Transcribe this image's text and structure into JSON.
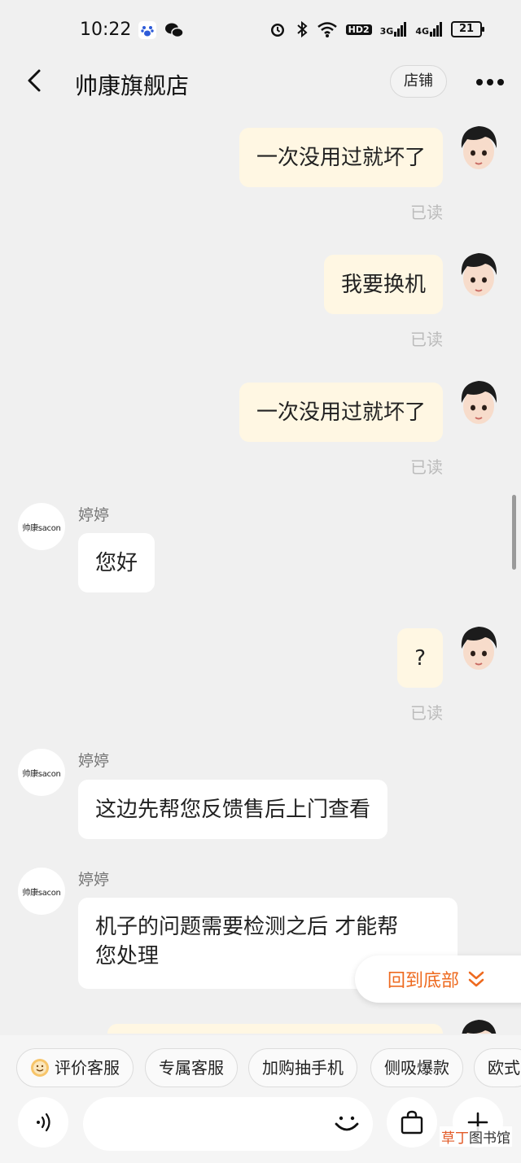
{
  "status_bar": {
    "time": "10:22",
    "signals": [
      "HD2",
      "3G",
      "4G"
    ],
    "battery": "21"
  },
  "header": {
    "title": "帅康旗舰店",
    "shop_button": "店铺"
  },
  "messages": [
    {
      "side": "right",
      "text": "一次没用过就坏了",
      "status": "已读"
    },
    {
      "side": "right",
      "text": "我要换机",
      "status": "已读"
    },
    {
      "side": "right",
      "text": "一次没用过就坏了",
      "status": "已读"
    },
    {
      "side": "left",
      "sender": "婷婷",
      "avatar_text": "帅康sacon",
      "text": "您好"
    },
    {
      "side": "right",
      "text": "?",
      "status": "已读"
    },
    {
      "side": "left",
      "sender": "婷婷",
      "avatar_text": "帅康sacon",
      "text": "这边先帮您反馈售后上门查看"
    },
    {
      "side": "left",
      "sender": "婷婷",
      "avatar_text": "帅康sacon",
      "text_lines": [
        "机子的问题需要检测之后 才能帮",
        "您处理"
      ]
    }
  ],
  "back_to_bottom": "回到底部",
  "quick_replies": [
    "评价客服",
    "专属客服",
    "加购抽手机",
    "侧吸爆款",
    "欧式"
  ],
  "watermark": {
    "accent": "草丁",
    "rest": "图书馆"
  },
  "colors": {
    "background": "#f0f0f0",
    "self_bubble": "#fff7e3",
    "other_bubble": "#ffffff",
    "accent_orange": "#ee6a1f",
    "read_text": "#bbbbbb"
  }
}
